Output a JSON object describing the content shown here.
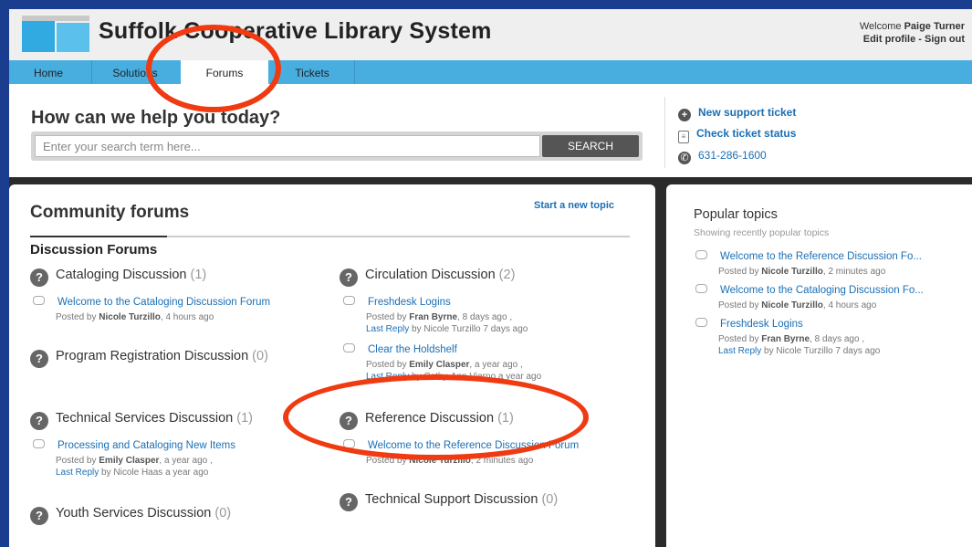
{
  "header": {
    "site_title": "Suffolk Cooperative Library System",
    "welcome_prefix": "Welcome",
    "user_name": "Paige Turner",
    "edit_profile": "Edit profile",
    "separator": "-",
    "sign_out": "Sign out"
  },
  "nav": {
    "items": [
      {
        "label": "Home"
      },
      {
        "label": "Solutions"
      },
      {
        "label": "Forums",
        "active": true
      },
      {
        "label": "Tickets"
      }
    ]
  },
  "help": {
    "title": "How can we help you today?",
    "search_placeholder": "Enter your search term here...",
    "search_button": "SEARCH",
    "links": [
      {
        "label": "New support ticket",
        "icon": "plus-icon"
      },
      {
        "label": "Check ticket status",
        "icon": "document-icon"
      },
      {
        "label": "631-286-1600",
        "icon": "phone-icon"
      }
    ]
  },
  "forums": {
    "title": "Community forums",
    "new_topic": "Start a new topic",
    "subtitle": "Discussion Forums",
    "categories": [
      {
        "name": "Cataloging Discussion",
        "count": "(1)",
        "topics": [
          {
            "title": "Welcome to the Cataloging Discussion Forum",
            "posted_by": "Nicole Turzillo",
            "posted_when": "4 hours ago"
          }
        ]
      },
      {
        "name": "Circulation Discussion",
        "count": "(2)",
        "topics": [
          {
            "title": "Freshdesk Logins",
            "posted_by": "Fran Byrne",
            "posted_when": "8 days ago ,",
            "last_reply_by": "Nicole Turzillo",
            "last_reply_when": "7 days ago"
          },
          {
            "title": "Clear the Holdshelf",
            "posted_by": "Emily Clasper",
            "posted_when": "a year ago ,",
            "last_reply_by": "Cathy-Ann Vierno",
            "last_reply_when": "a year ago"
          }
        ]
      },
      {
        "name": "Program Registration Discussion",
        "count": "(0)",
        "topics": []
      },
      {
        "name": "Technical Services Discussion",
        "count": "(1)",
        "topics": [
          {
            "title": "Processing and Cataloging New Items",
            "posted_by": "Emily Clasper",
            "posted_when": "a year ago ,",
            "last_reply_by": "Nicole Haas",
            "last_reply_when": "a year ago"
          }
        ]
      },
      {
        "name": "Reference Discussion",
        "count": "(1)",
        "topics": [
          {
            "title": "Welcome to the Reference Discussion Forum",
            "posted_by": "Nicole Turzillo",
            "posted_when": "2 minutes ago"
          }
        ]
      },
      {
        "name": "Technical Support Discussion",
        "count": "(0)",
        "topics": []
      },
      {
        "name": "Youth Services Discussion",
        "count": "(0)",
        "topics": []
      }
    ],
    "posted_by_label": "Posted by",
    "last_reply_label": "Last Reply",
    "by_label": "by"
  },
  "popular": {
    "title": "Popular topics",
    "subtitle": "Showing recently popular topics",
    "items": [
      {
        "title": "Welcome to the Reference Discussion Fo...",
        "posted_by": "Nicole Turzillo",
        "posted_when": "2 minutes ago"
      },
      {
        "title": "Welcome to the Cataloging Discussion Fo...",
        "posted_by": "Nicole Turzillo",
        "posted_when": "4 hours ago"
      },
      {
        "title": "Freshdesk Logins",
        "posted_by": "Fran Byrne",
        "posted_when": "8 days ago ,",
        "last_reply_by": "Nicole Turzillo",
        "last_reply_when": "7 days ago"
      }
    ]
  },
  "annotation_color": "#f03a12"
}
